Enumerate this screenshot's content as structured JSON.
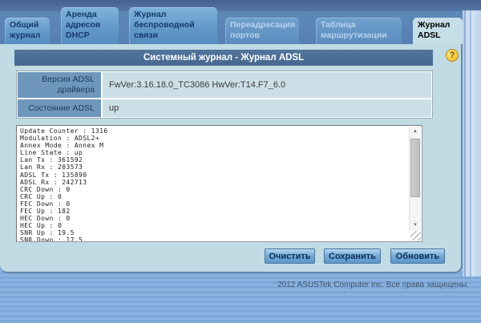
{
  "header": {
    "tabs": [
      {
        "label": "Общий журнал",
        "active": false
      },
      {
        "label": "Аренда адресов DHCP",
        "active": false
      },
      {
        "label": "Журнал беспроводной связи",
        "active": false
      },
      {
        "label": "Переадресация портов",
        "active": false
      },
      {
        "label": "Таблица маршрутизации",
        "active": false
      },
      {
        "label": "Журнал ADSL",
        "active": true
      }
    ]
  },
  "panel": {
    "title": "Системный журнал - Журнал ADSL",
    "help_icon": "?",
    "info_rows": [
      {
        "label": "Версия ADSL драйвера",
        "value": "FwVer:3.16.18.0_TC3086 HwVer:T14.F7_6.0"
      },
      {
        "label": "Состояние ADSL",
        "value": "up"
      }
    ],
    "log_text": "Update Counter : 1316\nModulation : ADSL2+\nAnnex Mode : Annex M\nLine State : up\nLan Tx : 361592\nLan Rx : 203573\nADSL Tx : 135890\nADSL Rx : 242713\nCRC Down : 0\nCRC Up : 0\nFEC Down : 0\nFEC Up : 182\nHEC Down : 0\nHEC Up : 0\nSNR Up : 19.5\nSNR Down : 17.5",
    "buttons": {
      "clear": "Очистить",
      "save": "Сохранить",
      "refresh": "Обновить"
    }
  },
  "icons": {
    "scroll_up": "▲",
    "scroll_down": "▼"
  },
  "footer": {
    "copyright": "2012 ASUSTek Computer Inc. Все права защищены."
  },
  "colors": {
    "top_band": "#44618f",
    "tab_row_bg": "#5b83b4",
    "tab_inactive": "#6298c8",
    "panel_bg": "#c0dbe4",
    "title_bar": "#4a6c93",
    "label_cell": "#6f97bb",
    "value_cell": "#ccdfe7",
    "help_gold": "#f0b429",
    "button_face": "#79abd6",
    "footer_stripe_light": "#8bb2e0",
    "footer_stripe_dark": "#7ca7d7"
  }
}
